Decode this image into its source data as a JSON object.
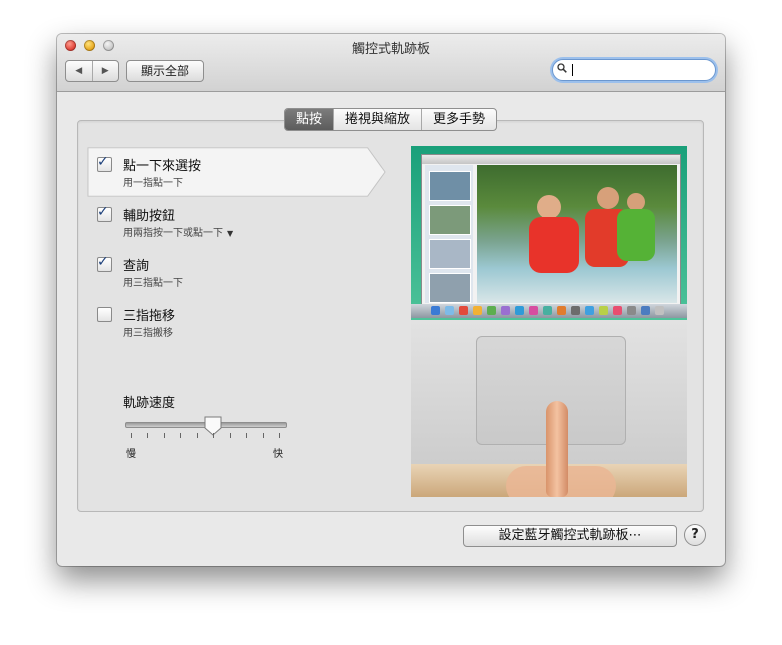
{
  "window": {
    "title": "觸控式軌跡板"
  },
  "toolbar": {
    "back_icon": "◀",
    "forward_icon": "▶",
    "show_all_label": "顯示全部",
    "search_placeholder": ""
  },
  "tabs": [
    {
      "label": "點按",
      "active": true
    },
    {
      "label": "捲視與縮放",
      "active": false
    },
    {
      "label": "更多手勢",
      "active": false
    }
  ],
  "options": [
    {
      "title": "點一下來選按",
      "subtitle": "用一指點一下",
      "checked": true
    },
    {
      "title": "輔助按鈕",
      "subtitle": "用兩指按一下或點一下",
      "checked": true,
      "has_menu": true
    },
    {
      "title": "查詢",
      "subtitle": "用三指點一下",
      "checked": true
    },
    {
      "title": "三指拖移",
      "subtitle": "用三指搬移",
      "checked": false
    }
  ],
  "tracking_speed": {
    "label": "軌跡速度",
    "min_label": "慢",
    "max_label": "快",
    "value_fraction": 0.55,
    "ticks": 10
  },
  "footer": {
    "bluetooth_button": "設定藍牙觸控式軌跡板⋯",
    "help": "?"
  },
  "icons": {
    "check": "✓",
    "menu_triangle": "▼"
  }
}
